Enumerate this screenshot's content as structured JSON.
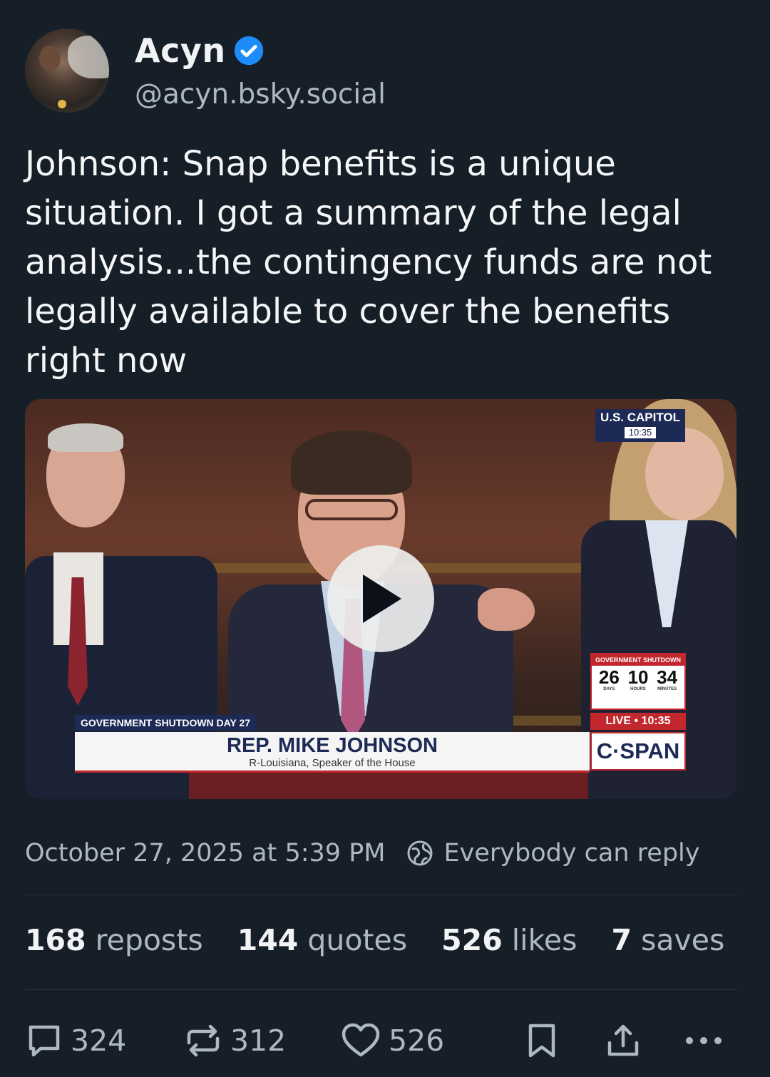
{
  "author": {
    "display_name": "Acyn",
    "handle": "@acyn.bsky.social",
    "verified_icon": "verified-check-icon",
    "verified_color": "#1d8cf8"
  },
  "post": {
    "text": "Johnson: Snap benefits is a unique situation. I got a summary of the legal analysis...the contingency funds are not legally available to cover the benefits right now"
  },
  "video": {
    "play_icon": "play-icon",
    "overlay": {
      "capitol_label": "U.S. CAPITOL",
      "capitol_time": "10:35",
      "shutdown_header": "GOVERNMENT SHUTDOWN",
      "countdown": [
        {
          "value": "26",
          "label": "DAYS"
        },
        {
          "value": "10",
          "label": "HOURS"
        },
        {
          "value": "34",
          "label": "MINUTES"
        }
      ],
      "live_text": "LIVE • 10:35",
      "network": "C·SPAN",
      "chyron_tag": "GOVERNMENT SHUTDOWN DAY 27",
      "chyron_name": "REP. MIKE JOHNSON",
      "chyron_subtitle": "R-Louisiana, Speaker of the House"
    }
  },
  "meta": {
    "timestamp": "October 27, 2025 at 5:39 PM",
    "reply_setting": "Everybody can reply"
  },
  "stats": {
    "reposts_count": "168",
    "reposts_label": "reposts",
    "quotes_count": "144",
    "quotes_label": "quotes",
    "likes_count": "526",
    "likes_label": "likes",
    "saves_count": "7",
    "saves_label": "saves"
  },
  "actions": {
    "reply_count": "324",
    "repost_count": "312",
    "like_count": "526"
  },
  "colors": {
    "background": "#161e27",
    "text_primary": "#f1f3f5",
    "text_secondary": "#aeb8c4",
    "divider": "#2c3540"
  }
}
